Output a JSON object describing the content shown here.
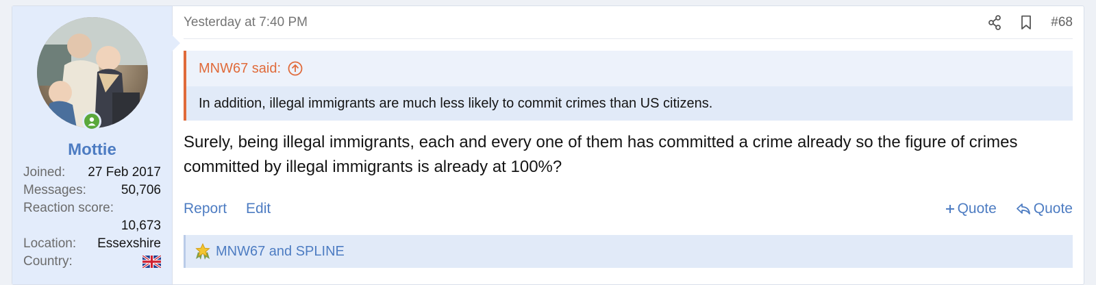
{
  "user": {
    "name": "Mottie",
    "stats": [
      {
        "label": "Joined:",
        "value": "27 Feb 2017"
      },
      {
        "label": "Messages:",
        "value": "50,706"
      },
      {
        "label": "Reaction score:",
        "value": "10,673"
      },
      {
        "label": "Location:",
        "value": "Essexshire"
      },
      {
        "label": "Country:",
        "value": ""
      }
    ]
  },
  "post": {
    "timestamp": "Yesterday at 7:40 PM",
    "number": "#68",
    "quote_author": "MNW67 said:",
    "quote_text": "In addition, illegal immigrants are much less likely to commit crimes than US citizens.",
    "message": "Surely, being illegal immigrants, each and every one of them has committed a crime already so the figure of crimes committed by illegal immigrants is already at 100%?"
  },
  "actions": {
    "report": "Report",
    "edit": "Edit",
    "multi_quote": "Quote",
    "quote": "Quote"
  },
  "reactions": {
    "text": "MNW67 and SPLINE"
  },
  "colors": {
    "accent": "#4d7cc2",
    "quote_border": "#e06a3a",
    "online": "#5aa83b"
  }
}
